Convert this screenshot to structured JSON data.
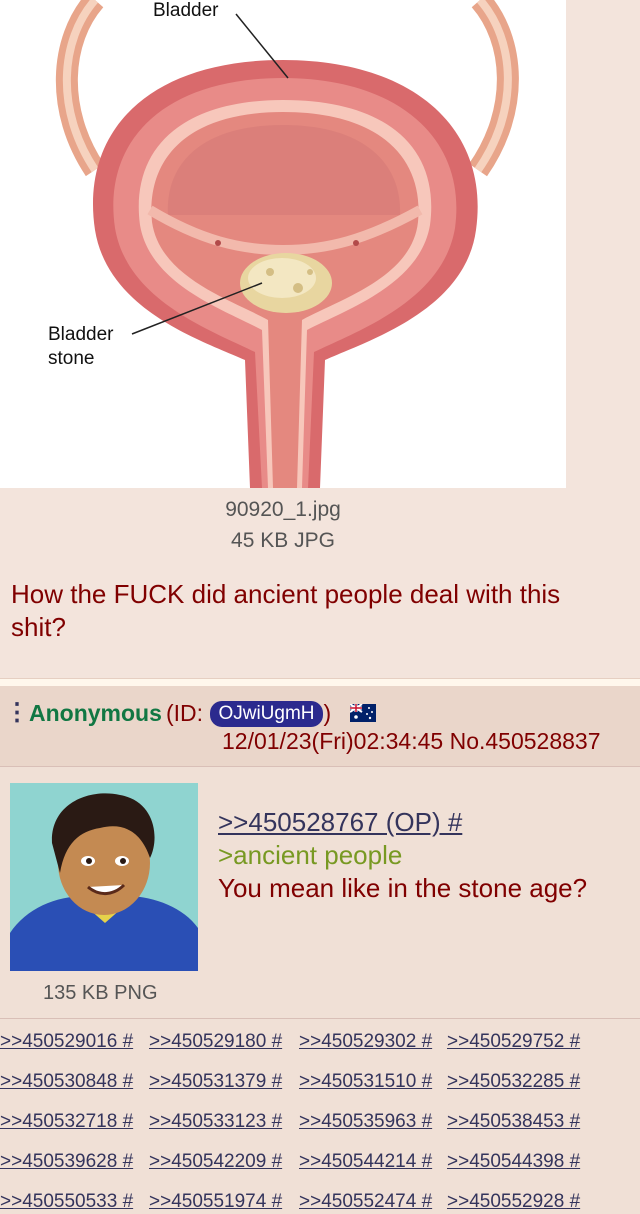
{
  "op": {
    "image_labels": {
      "top": "Bladder",
      "stone_line1": "Bladder",
      "stone_line2": "stone"
    },
    "filename": "90920_1.jpg",
    "filesize": "45 KB JPG",
    "text": "How the FUCK did ancient people deal with this shit?"
  },
  "reply": {
    "menu_icon": "⋮",
    "name": "Anonymous",
    "id_prefix": "(ID: ",
    "id": "OJwiUgmH",
    "id_suffix": ")",
    "flag": "australia-flag-icon",
    "datetime": "12/01/23(Fri)02:34:45 No.450528837",
    "quote": ">>450528767 (OP) #",
    "greentext": ">ancient people",
    "message": "You mean like in the stone age?",
    "thumb_meta": "135 KB PNG"
  },
  "backlinks": [
    [
      ">>450529016 #",
      ">>450529180 #",
      ">>450529302 #",
      ">>450529752 #"
    ],
    [
      ">>450530848 #",
      ">>450531379 #",
      ">>450531510 #",
      ">>450532285 #"
    ],
    [
      ">>450532718 #",
      ">>450533123 #",
      ">>450535963 #",
      ">>450538453 #"
    ],
    [
      ">>450539628 #",
      ">>450542209 #",
      ">>450544214 #",
      ">>450544398 #"
    ],
    [
      ">>450550533 #",
      ">>450551974 #",
      ">>450552474 #",
      ">>450552928 #"
    ]
  ],
  "colors": {
    "bg": "#f0e0d6",
    "name": "#117743",
    "text": "#800000",
    "link": "#34345c",
    "greentext": "#789922",
    "id_badge": "#2b2a8e"
  }
}
